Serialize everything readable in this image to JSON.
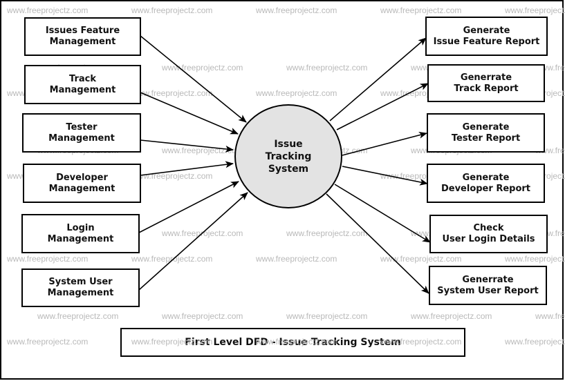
{
  "diagram": {
    "title": "First Level DFD - Issue Tracking System",
    "watermark": "www.freeprojectz.com",
    "colors": {
      "process_fill": "#e3e3e3",
      "stroke": "#000000",
      "watermark": "#b9b9b9"
    },
    "process": {
      "lines": [
        "Issue",
        "Tracking",
        "System"
      ]
    },
    "inputs": [
      {
        "id": "issues-feature-management",
        "lines": [
          "Issues Feature",
          "Management"
        ]
      },
      {
        "id": "track-management",
        "lines": [
          "Track",
          "Management"
        ]
      },
      {
        "id": "tester-management",
        "lines": [
          "Tester",
          "Management"
        ]
      },
      {
        "id": "developer-management",
        "lines": [
          "Developer",
          "Management"
        ]
      },
      {
        "id": "login-management",
        "lines": [
          "Login",
          "Management"
        ]
      },
      {
        "id": "system-user-management",
        "lines": [
          "System User",
          "Management"
        ]
      }
    ],
    "outputs": [
      {
        "id": "generate-issue-feature-report",
        "lines": [
          "Generate",
          "Issue Feature Report"
        ]
      },
      {
        "id": "generrate-track-report",
        "lines": [
          "Generrate",
          "Track Report"
        ]
      },
      {
        "id": "generate-tester-report",
        "lines": [
          "Generate",
          "Tester Report"
        ]
      },
      {
        "id": "generate-developer-report",
        "lines": [
          "Generate",
          "Developer Report"
        ]
      },
      {
        "id": "check-user-login-details",
        "lines": [
          "Check",
          "User Login Details"
        ]
      },
      {
        "id": "generrate-system-user-report",
        "lines": [
          "Generrate",
          "System User Report"
        ]
      }
    ],
    "flows": [
      {
        "from": "issues-feature-management",
        "to": "process"
      },
      {
        "from": "track-management",
        "to": "process"
      },
      {
        "from": "tester-management",
        "to": "process"
      },
      {
        "from": "developer-management",
        "to": "process"
      },
      {
        "from": "login-management",
        "to": "process"
      },
      {
        "from": "system-user-management",
        "to": "process"
      },
      {
        "from": "process",
        "to": "generate-issue-feature-report"
      },
      {
        "from": "process",
        "to": "generrate-track-report"
      },
      {
        "from": "process",
        "to": "generate-tester-report"
      },
      {
        "from": "process",
        "to": "generate-developer-report"
      },
      {
        "from": "process",
        "to": "check-user-login-details"
      },
      {
        "from": "process",
        "to": "generrate-system-user-report"
      }
    ]
  }
}
